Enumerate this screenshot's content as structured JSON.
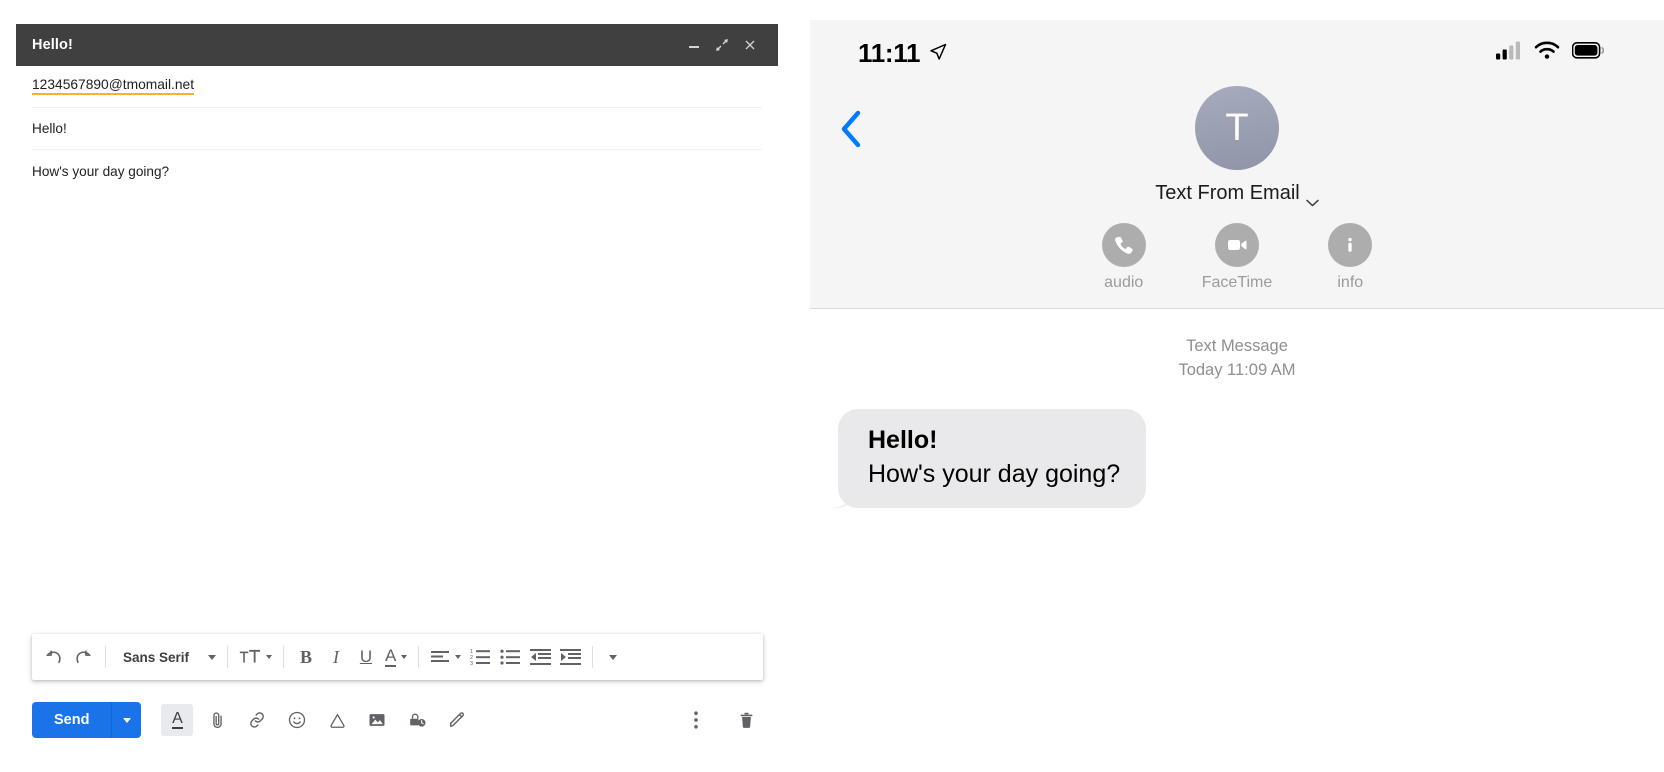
{
  "compose": {
    "title": "Hello!",
    "window_buttons": [
      {
        "name": "minimize",
        "glyph": "minimize-icon"
      },
      {
        "name": "popout",
        "glyph": "popout-icon"
      },
      {
        "name": "close",
        "glyph": "close-icon"
      }
    ],
    "to": "1234567890@tmomail.net",
    "subject": "Hello!",
    "body": "How's your day going?",
    "toolbar": {
      "undo": "undo-icon",
      "redo": "redo-icon",
      "font_family": "Sans Serif",
      "font_size": "font-size-icon",
      "bold": "B",
      "italic": "I",
      "underline": "U",
      "text_color": "A",
      "align": "align-icon",
      "numbered_list": "numbered-list-icon",
      "bulleted_list": "bulleted-list-icon",
      "indent_less": "indent-less-icon",
      "indent_more": "indent-more-icon",
      "more_options": "more-options-icon"
    },
    "send_label": "Send",
    "bottom_icons": [
      {
        "name": "formatting-options-icon",
        "label": "A"
      },
      {
        "name": "attach-file-icon",
        "label": ""
      },
      {
        "name": "insert-link-icon",
        "label": ""
      },
      {
        "name": "insert-emoji-icon",
        "label": ""
      },
      {
        "name": "insert-drive-icon",
        "label": ""
      },
      {
        "name": "insert-photo-icon",
        "label": ""
      },
      {
        "name": "confidential-mode-icon",
        "label": ""
      },
      {
        "name": "insert-signature-icon",
        "label": ""
      }
    ],
    "more_label": "more-options-icon",
    "discard_label": "discard-draft-icon"
  },
  "phone": {
    "status": {
      "time": "11:11",
      "location_icon": "location-arrow-icon",
      "cellular_icon": "cellular-signal-icon",
      "wifi_icon": "wifi-icon",
      "battery_icon": "battery-icon"
    },
    "back_icon": "back-chevron-icon",
    "avatar_initial": "T",
    "contact_name": "Text From Email",
    "contact_chevron": "chevron-down-icon",
    "actions": [
      {
        "label": "audio",
        "icon": "phone-icon"
      },
      {
        "label": "FaceTime",
        "icon": "video-camera-icon"
      },
      {
        "label": "info",
        "icon": "info-icon"
      }
    ],
    "thread": {
      "service_label": "Text Message",
      "timestamp": "Today 11:09 AM",
      "message_line1": "Hello!",
      "message_line2": "How's your day going?"
    }
  },
  "colors": {
    "titlebar": "#404040",
    "send_blue": "#1a73e8",
    "to_underline": "#f5b325",
    "bubble_gray": "#e9e9eb",
    "ios_blue": "#007aff"
  }
}
